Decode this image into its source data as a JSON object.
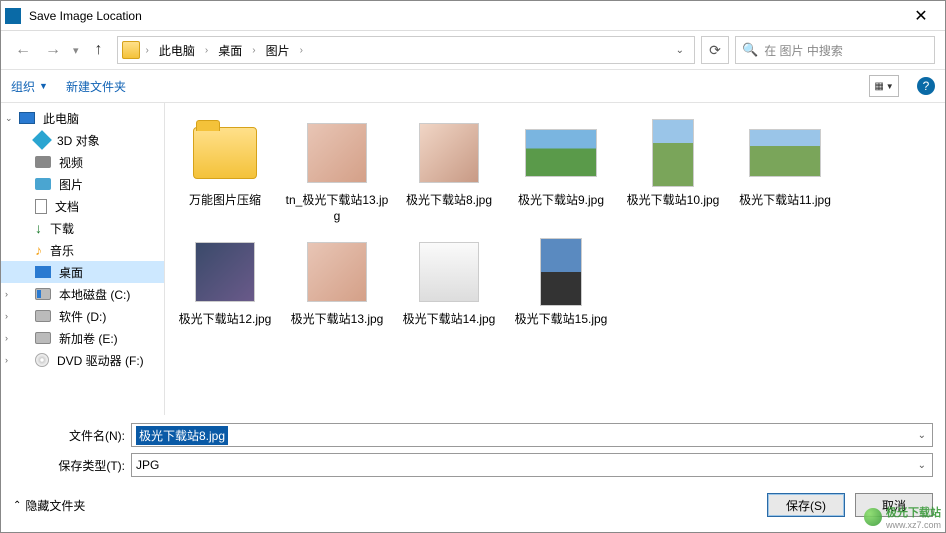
{
  "window": {
    "title": "Save Image Location"
  },
  "address": {
    "crumbs": [
      "此电脑",
      "桌面",
      "图片"
    ],
    "search_placeholder": "在 图片 中搜索"
  },
  "toolbar": {
    "organize": "组织",
    "new_folder": "新建文件夹"
  },
  "sidebar": {
    "root": "此电脑",
    "items": [
      {
        "label": "3D 对象",
        "icon": "3d"
      },
      {
        "label": "视频",
        "icon": "vid"
      },
      {
        "label": "图片",
        "icon": "img"
      },
      {
        "label": "文档",
        "icon": "doc"
      },
      {
        "label": "下载",
        "icon": "dl"
      },
      {
        "label": "音乐",
        "icon": "mus"
      },
      {
        "label": "桌面",
        "icon": "desk",
        "selected": true
      },
      {
        "label": "本地磁盘 (C:)",
        "icon": "diskc"
      },
      {
        "label": "软件 (D:)",
        "icon": "disk"
      },
      {
        "label": "新加卷 (E:)",
        "icon": "disk"
      },
      {
        "label": "DVD 驱动器 (F:)",
        "icon": "dvd"
      }
    ]
  },
  "files": [
    {
      "name": "万能图片压缩",
      "type": "folder"
    },
    {
      "name": "tn_极光下载站13.jpg",
      "type": "image",
      "shape": "sq",
      "cls": "c-face"
    },
    {
      "name": "极光下载站8.jpg",
      "type": "image",
      "shape": "sq",
      "cls": "c-face2"
    },
    {
      "name": "极光下载站9.jpg",
      "type": "image",
      "shape": "wide",
      "cls": "c-land"
    },
    {
      "name": "极光下载站10.jpg",
      "type": "image",
      "shape": "tall",
      "cls": "c-land2"
    },
    {
      "name": "极光下载站11.jpg",
      "type": "image",
      "shape": "wide",
      "cls": "c-land2"
    },
    {
      "name": "极光下载站12.jpg",
      "type": "image",
      "shape": "sq",
      "cls": "c-anime"
    },
    {
      "name": "极光下载站13.jpg",
      "type": "image",
      "shape": "sq",
      "cls": "c-face"
    },
    {
      "name": "极光下载站14.jpg",
      "type": "image",
      "shape": "sq",
      "cls": "c-white"
    },
    {
      "name": "极光下载站15.jpg",
      "type": "image",
      "shape": "tall",
      "cls": "c-model"
    }
  ],
  "form": {
    "filename_label": "文件名(N):",
    "filename_value": "极光下载站8.jpg",
    "type_label": "保存类型(T):",
    "type_value": "JPG"
  },
  "footer": {
    "hide_folders": "隐藏文件夹",
    "save": "保存(S)",
    "cancel": "取消"
  },
  "watermark": {
    "text": "极光下载站",
    "url": "www.xz7.com"
  }
}
